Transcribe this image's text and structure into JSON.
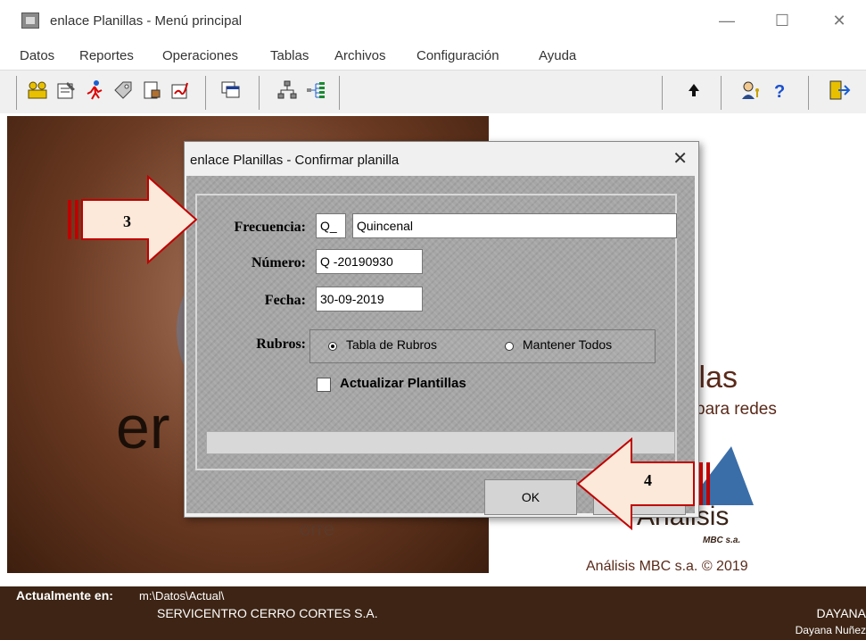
{
  "window": {
    "title": "enlace Planillas - Menú principal",
    "minimize_glyph": "—",
    "maximize_glyph": "☐",
    "close_glyph": "✕"
  },
  "menu": [
    "Datos",
    "Reportes",
    "Operaciones",
    "Tablas",
    "Archivos",
    "Configuración",
    "Ayuda"
  ],
  "toolbar": {
    "icons": [
      "users-icon",
      "edit-form-icon",
      "runner-icon",
      "tag-icon",
      "document-lock-icon",
      "signature-icon",
      "windows-icon",
      "network-icon",
      "tree-icon",
      "arrow-up-icon",
      "user-key-icon",
      "help-icon",
      "exit-door-icon"
    ]
  },
  "background": {
    "logo_partial": "er",
    "subtitle_partial": "orre",
    "product_partial": "llas",
    "product_sub_partial": "para redes",
    "brand_name": "Análisis",
    "brand_sub": "MBC s.a.",
    "copyright": "Análisis MBC s.a. © 2019"
  },
  "status": {
    "label": "Actualmente en:",
    "path": "m:\\Datos\\Actual\\",
    "company": "SERVICENTRO CERRO CORTES S.A.",
    "user_short": "DAYANA",
    "user_full": "Dayana Nuñez"
  },
  "dialog": {
    "title": "enlace Planillas - Confirmar planilla",
    "close_glyph": "✕",
    "frecuencia_label": "Frecuencia:",
    "frecuencia_code": "Q_",
    "frecuencia_name": "Quincenal",
    "numero_label": "Número:",
    "numero_value": "Q -20190930",
    "fecha_label": "Fecha:",
    "fecha_value": "30-09-2019",
    "rubros_label": "Rubros:",
    "option_tabla": "Tabla de Rubros",
    "option_mantener": "Mantener Todos",
    "checkbox_label": "Actualizar Plantillas",
    "ok_label": "OK"
  },
  "callouts": {
    "step3": "3",
    "step4": "4",
    "arrow_fill": "#fde9d9",
    "arrow_stroke": "#c00000"
  }
}
